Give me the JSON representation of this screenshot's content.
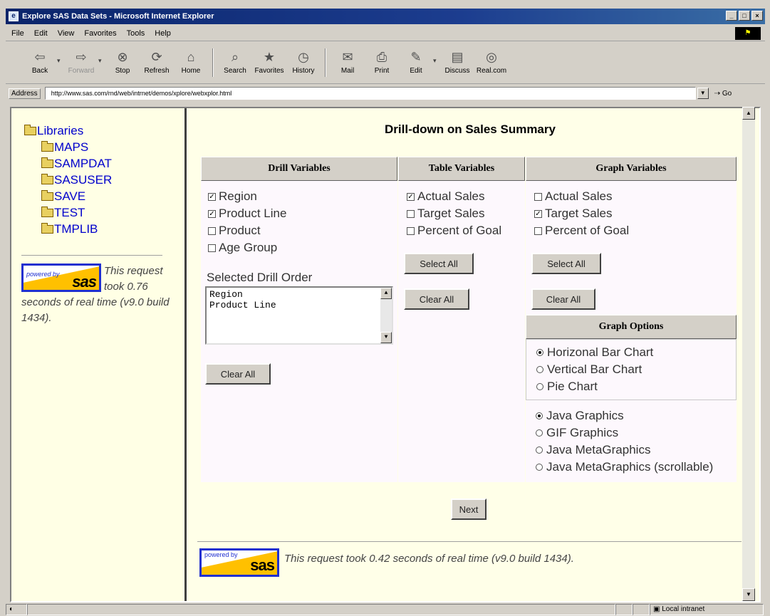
{
  "window": {
    "title": "Explore SAS Data Sets - Microsoft Internet Explorer",
    "minimize": "_",
    "maximize": "□",
    "close": "×"
  },
  "menu": [
    "File",
    "Edit",
    "View",
    "Favorites",
    "Tools",
    "Help"
  ],
  "toolbar": {
    "back": "Back",
    "forward": "Forward",
    "stop": "Stop",
    "refresh": "Refresh",
    "home": "Home",
    "search": "Search",
    "favorites": "Favorites",
    "history": "History",
    "mail": "Mail",
    "print": "Print",
    "edit": "Edit",
    "discuss": "Discuss",
    "realcom": "Real.com"
  },
  "address": {
    "label": "Address",
    "url": "http://www.sas.com/rnd/web/intrnet/demos/xplore/webxplor.html",
    "go": "Go"
  },
  "sidebar": {
    "root": "Libraries",
    "items": [
      "MAPS",
      "SAMPDAT",
      "SASUSER",
      "SAVE",
      "TEST",
      "TMPLIB"
    ],
    "logo_powered": "powered by",
    "logo_sas": "sas",
    "note": "This request took 0.76 seconds of real time (v9.0 build 1434)."
  },
  "main": {
    "title": "Drill-down on Sales Summary",
    "drill": {
      "header": "Drill Variables",
      "options": [
        {
          "label": "Region",
          "checked": true
        },
        {
          "label": "Product Line",
          "checked": true
        },
        {
          "label": "Product",
          "checked": false
        },
        {
          "label": "Age Group",
          "checked": false
        }
      ],
      "order_label": "Selected Drill Order",
      "order": [
        "Region",
        "Product Line"
      ],
      "clear": "Clear All"
    },
    "table": {
      "header": "Table Variables",
      "options": [
        {
          "label": "Actual Sales",
          "checked": true
        },
        {
          "label": "Target Sales",
          "checked": false
        },
        {
          "label": "Percent of Goal",
          "checked": false
        }
      ],
      "select_all": "Select All",
      "clear": "Clear All"
    },
    "graph": {
      "header": "Graph Variables",
      "options": [
        {
          "label": "Actual Sales",
          "checked": false
        },
        {
          "label": "Target Sales",
          "checked": true
        },
        {
          "label": "Percent of Goal",
          "checked": false
        }
      ],
      "select_all": "Select All",
      "clear": "Clear All"
    },
    "graph_options": {
      "header": "Graph Options",
      "chart_types": [
        {
          "label": "Horizonal Bar Chart",
          "selected": true
        },
        {
          "label": "Vertical Bar Chart",
          "selected": false
        },
        {
          "label": "Pie Chart",
          "selected": false
        }
      ],
      "renderers": [
        {
          "label": "Java Graphics",
          "selected": true
        },
        {
          "label": "GIF Graphics",
          "selected": false
        },
        {
          "label": "Java MetaGraphics",
          "selected": false
        },
        {
          "label": "Java MetaGraphics (scrollable)",
          "selected": false
        }
      ]
    },
    "next": "Next",
    "footer_note": "This request took 0.42 seconds of real time (v9.0 build 1434)."
  },
  "status": {
    "zone": "Local intranet"
  }
}
